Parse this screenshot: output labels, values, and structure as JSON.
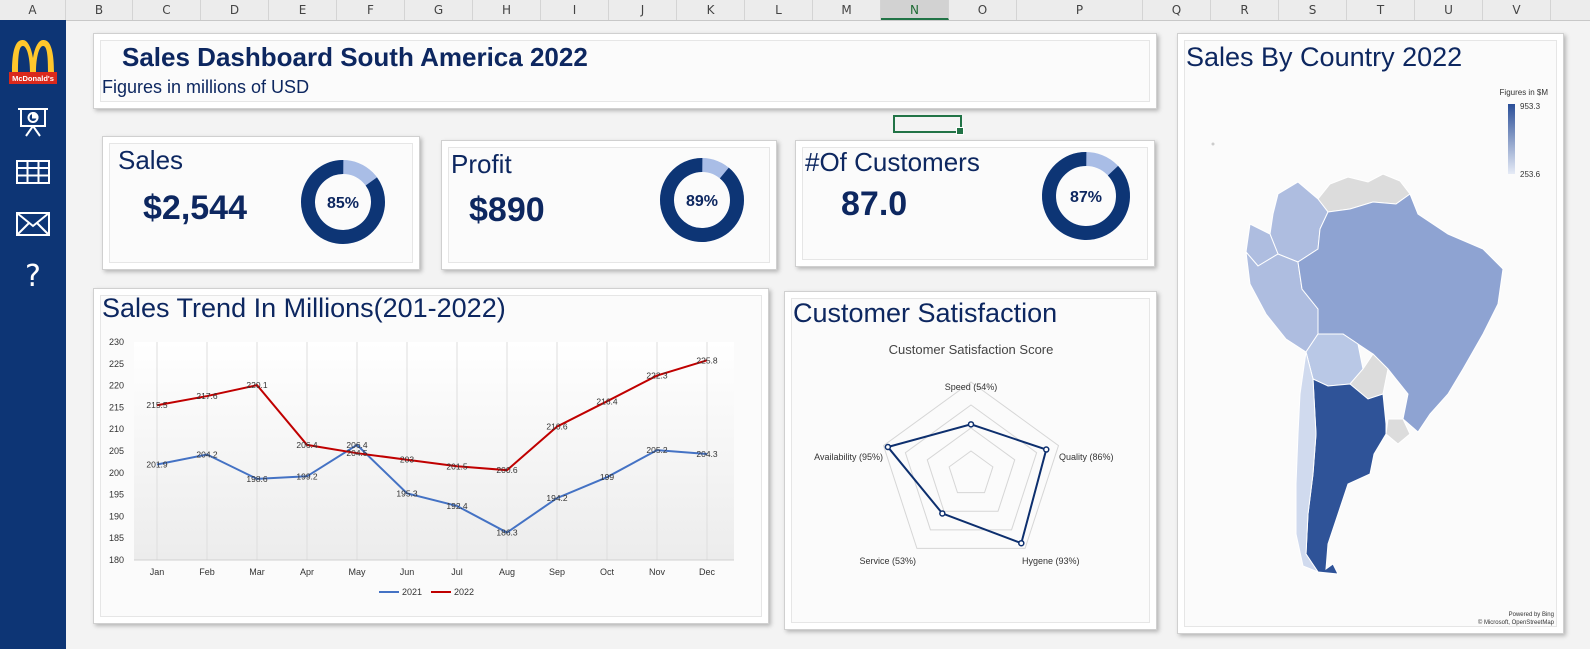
{
  "spreadsheet": {
    "columns": [
      "A",
      "B",
      "C",
      "D",
      "E",
      "F",
      "G",
      "H",
      "I",
      "J",
      "K",
      "L",
      "M",
      "N",
      "O",
      "P",
      "Q",
      "R",
      "S",
      "T",
      "U",
      "V"
    ],
    "selected_column": "N"
  },
  "sidebar": {
    "logo_text": "McDonald's",
    "items": [
      {
        "icon": "presentation-icon"
      },
      {
        "icon": "table-icon"
      },
      {
        "icon": "mail-icon"
      },
      {
        "icon": "help-icon",
        "glyph": "?"
      }
    ],
    "color": "#0d3575"
  },
  "header": {
    "title": "Sales Dashboard South America 2022",
    "subtitle": "Figures in millions of USD"
  },
  "kpis": [
    {
      "label": "Sales",
      "value": "$2,544",
      "percent_label": "85%",
      "percent": 85
    },
    {
      "label": "Profit",
      "value": "$890",
      "percent_label": "89%",
      "percent": 89
    },
    {
      "label": "#Of Customers",
      "value": "87.0",
      "percent_label": "87%",
      "percent": 87
    }
  ],
  "trend": {
    "title": "Sales Trend In Millions(201-2022)"
  },
  "satisfaction": {
    "title": "Customer Satisfaction"
  },
  "map": {
    "title": "Sales By Country 2022",
    "legend_title": "Figures in $M",
    "legend_max": "953.3",
    "legend_min": "253.6",
    "credit_line1": "Powered by Bing",
    "credit_line2": "© Microsoft, OpenStreetMap"
  },
  "colors": {
    "navy": "#0d3575",
    "donut_light": "#a9bde6",
    "series_2021": "#4472c4",
    "series_2022": "#c00000",
    "radar": "#0d2f6e"
  },
  "chart_data": [
    {
      "type": "line",
      "categories": [
        "Jan",
        "Feb",
        "Mar",
        "Apr",
        "May",
        "Jun",
        "Jul",
        "Aug",
        "Sep",
        "Oct",
        "Nov",
        "Dec"
      ],
      "series": [
        {
          "name": "2021",
          "values": [
            201.9,
            204.2,
            198.6,
            199.2,
            206.4,
            195.3,
            192.4,
            186.3,
            194.2,
            199,
            205.2,
            204.3
          ]
        },
        {
          "name": "2022",
          "values": [
            215.5,
            217.6,
            220.1,
            206.4,
            204.5,
            203,
            201.5,
            200.6,
            210.6,
            216.4,
            222.3,
            225.8
          ]
        }
      ],
      "ylim": [
        180,
        230
      ],
      "yticks": [
        180,
        185,
        190,
        195,
        200,
        205,
        210,
        215,
        220,
        225,
        230
      ],
      "legend": "bottom",
      "grid": "vertical"
    },
    {
      "type": "radar",
      "title": "Customer Satisfaction Score",
      "categories": [
        "Speed (54%)",
        "Quality (86%)",
        "Hygene (93%)",
        "Service (53%)",
        "Availability (95%)"
      ],
      "values": [
        54,
        86,
        93,
        53,
        95
      ],
      "rlim": [
        0,
        100
      ]
    }
  ]
}
